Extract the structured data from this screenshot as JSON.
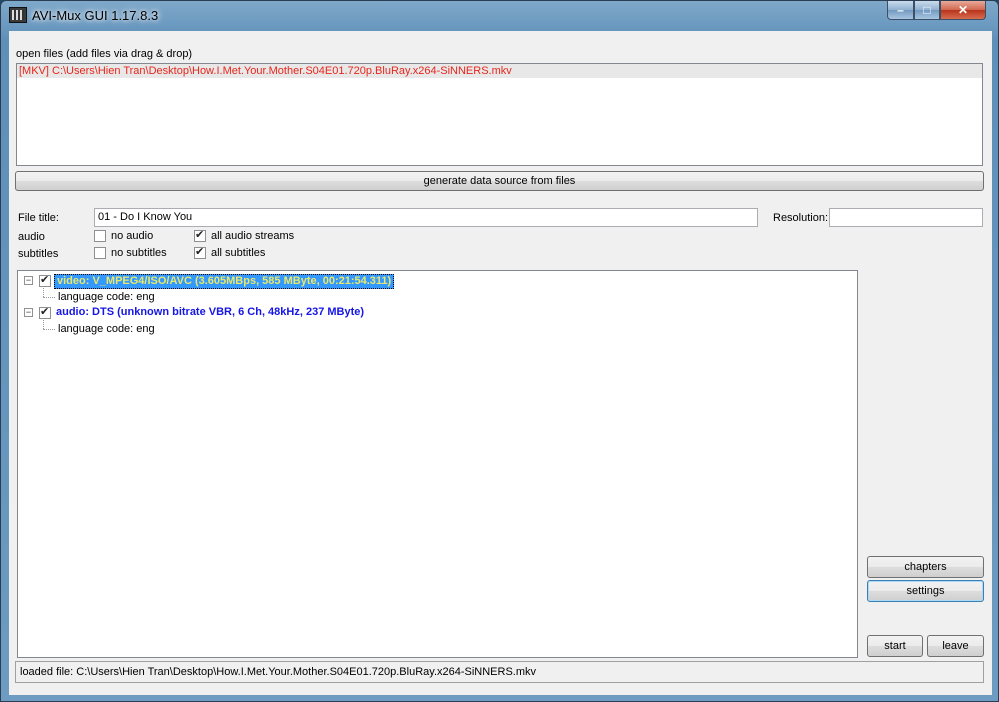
{
  "window": {
    "title": "AVI-Mux GUI 1.17.8.3",
    "controls": {
      "minimize": "–",
      "maximize": "□",
      "close": "✕"
    }
  },
  "open_files": {
    "label": "open files (add files via drag & drop)",
    "items": [
      "[MKV] C:\\Users\\Hien Tran\\Desktop\\How.I.Met.Your.Mother.S04E01.720p.BluRay.x264-SiNNERS.mkv"
    ],
    "item_color": "#e8261b"
  },
  "generate_button": "generate data source from files",
  "file_title": {
    "label": "File title:",
    "value": "01 - Do I Know You"
  },
  "resolution": {
    "label": "Resolution:",
    "value": ""
  },
  "audio": {
    "label": "audio",
    "no_audio": {
      "label": "no audio",
      "checked": false
    },
    "all_audio": {
      "label": "all audio streams",
      "checked": true
    }
  },
  "subtitles": {
    "label": "subtitles",
    "no_subtitles": {
      "label": "no subtitles",
      "checked": false
    },
    "all_subtitles": {
      "label": "all subtitles",
      "checked": true
    }
  },
  "streams": [
    {
      "label": "video: V_MPEG4/ISO/AVC (3.605MBps, 585 MByte, 00:21:54.311)",
      "checked": true,
      "selected": true,
      "expanded": true,
      "children": [
        "language code: eng"
      ]
    },
    {
      "label": "audio: DTS (unknown bitrate VBR, 6 Ch, 48kHz, 237 MByte)",
      "checked": true,
      "selected": false,
      "expanded": true,
      "children": [
        "language code: eng"
      ]
    }
  ],
  "buttons": {
    "chapters": "chapters",
    "settings": "settings",
    "start": "start",
    "leave": "leave"
  },
  "status": "loaded file: C:\\Users\\Hien Tran\\Desktop\\How.I.Met.Your.Mother.S04E01.720p.BluRay.x264-SiNNERS.mkv",
  "colors": {
    "video_stream": "#e9e86a",
    "selection": "#3399ff",
    "audio_stream": "#1515e6"
  }
}
